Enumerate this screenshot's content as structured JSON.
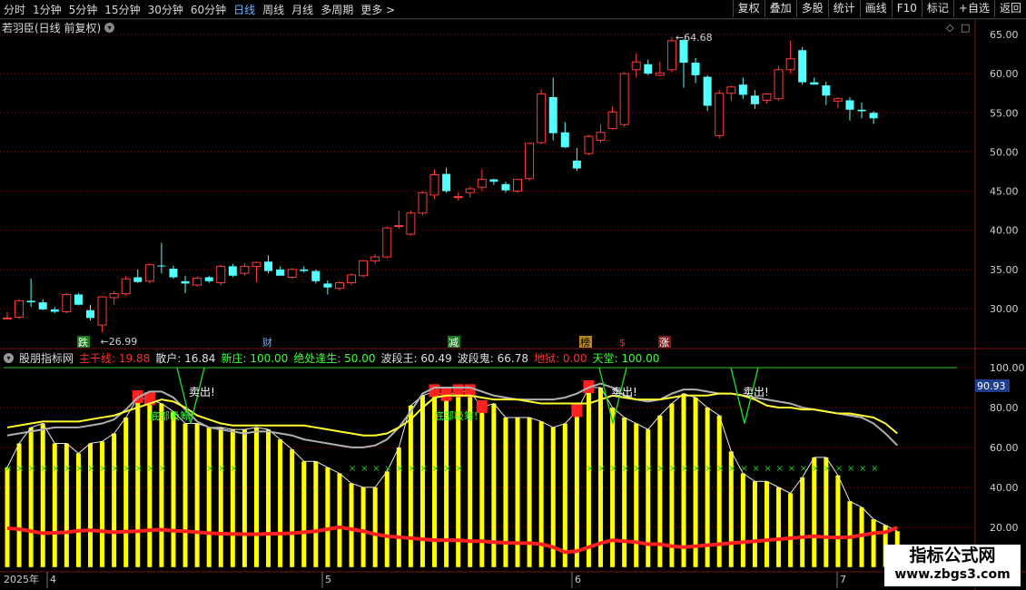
{
  "toolbar": {
    "periods": [
      "分时",
      "1分钟",
      "5分钟",
      "15分钟",
      "30分钟",
      "60分钟",
      "日线",
      "周线",
      "月线",
      "多周期",
      "更多 >"
    ],
    "active_period": "日线",
    "buttons": [
      "复权",
      "叠加",
      "多股",
      "统计",
      "画线",
      "F10",
      "标记",
      "+自选",
      "返回"
    ]
  },
  "main_header": {
    "title": "若羽臣(日线 前复权)",
    "menu_icon": "chevron-down-icon"
  },
  "price_axis": {
    "ticks": [
      "65.00",
      "60.00",
      "55.00",
      "50.00",
      "45.00",
      "40.00",
      "35.00",
      "30.00"
    ],
    "max": 64.68,
    "min": 26.99,
    "max_label": "64.68",
    "min_label": "26.99"
  },
  "signals": [
    {
      "text": "跌",
      "bg": "#1e7a1e",
      "fg": "#ffffff"
    },
    {
      "text": "财",
      "bg": "#000000",
      "fg": "#6bb7ff"
    },
    {
      "text": "减",
      "bg": "#1e7a1e",
      "fg": "#ffffff"
    },
    {
      "text": "榜",
      "bg": "#b58a1e",
      "fg": "#000000"
    },
    {
      "text": "$",
      "bg": "#000000",
      "fg": "#ff3030"
    },
    {
      "text": "涨",
      "bg": "#7a1e1e",
      "fg": "#ffffff"
    }
  ],
  "indicator": {
    "name": "股朋指标网",
    "items": [
      {
        "label": "主干线: 19.88",
        "color": "#ff3030"
      },
      {
        "label": "散户: 16.84",
        "color": "#e0e0e0"
      },
      {
        "label": "新庄: 100.00",
        "color": "#40ff40"
      },
      {
        "label": "绝处逢生: 50.00",
        "color": "#40ff40"
      },
      {
        "label": "波段王: 60.49",
        "color": "#e0e0e0"
      },
      {
        "label": "波段鬼: 66.78",
        "color": "#e0e0e0"
      },
      {
        "label": "地狱: 0.00",
        "color": "#ff3030"
      },
      {
        "label": "天堂: 100.00",
        "color": "#40ff40"
      }
    ],
    "axis_ticks": [
      "100.00",
      "80.00",
      "60.00",
      "40.00",
      "20.00"
    ],
    "current_value": "90.93",
    "annotations": {
      "sell": "卖出!",
      "bottom": "底部吸筹!"
    }
  },
  "time_axis": {
    "year_label": "2025年",
    "months": [
      "4",
      "5",
      "6",
      "7"
    ]
  },
  "watermark": {
    "line1": "指标公式网",
    "line2": "www.zbgs3.com"
  },
  "colors": {
    "up": "#ff3c3c",
    "down": "#54ffff",
    "bar_yellow": "#ffff00",
    "grid": "#7a1010",
    "green": "#22cc22"
  },
  "chart_data": {
    "type": "candlestick",
    "candles": [
      [
        28.7,
        29.6,
        28.6,
        28.8
      ],
      [
        28.9,
        31.2,
        28.7,
        31.0
      ],
      [
        31.0,
        33.8,
        30.2,
        30.8
      ],
      [
        30.8,
        31.2,
        29.8,
        29.9
      ],
      [
        29.9,
        30.2,
        29.4,
        29.6
      ],
      [
        29.6,
        32.0,
        29.4,
        31.8
      ],
      [
        31.8,
        32.0,
        30.4,
        30.5
      ],
      [
        29.8,
        30.5,
        28.5,
        28.8
      ],
      [
        27.9,
        31.6,
        26.99,
        31.5
      ],
      [
        31.4,
        32.2,
        30.5,
        31.9
      ],
      [
        31.9,
        34.2,
        31.6,
        33.8
      ],
      [
        34.0,
        35.0,
        33.3,
        33.4
      ],
      [
        33.5,
        35.8,
        33.2,
        35.6
      ],
      [
        35.5,
        38.4,
        34.5,
        35.4
      ],
      [
        35.1,
        35.5,
        33.8,
        34.0
      ],
      [
        33.5,
        34.2,
        32.0,
        33.2
      ],
      [
        33.0,
        34.1,
        32.8,
        33.9
      ],
      [
        34.0,
        34.2,
        33.3,
        33.5
      ],
      [
        33.3,
        35.6,
        33.0,
        35.4
      ],
      [
        35.4,
        35.7,
        34.0,
        34.2
      ],
      [
        34.5,
        35.8,
        34.2,
        35.4
      ],
      [
        35.4,
        36.0,
        33.4,
        35.9
      ],
      [
        36.0,
        36.8,
        34.5,
        34.8
      ],
      [
        35.0,
        35.4,
        34.6,
        34.2
      ],
      [
        34.0,
        35.2,
        33.8,
        35.0
      ],
      [
        35.0,
        35.4,
        34.6,
        34.8
      ],
      [
        34.8,
        35.0,
        33.2,
        33.5
      ],
      [
        33.2,
        33.6,
        31.8,
        32.7
      ],
      [
        32.6,
        33.5,
        32.3,
        33.3
      ],
      [
        33.3,
        34.5,
        33.0,
        34.3
      ],
      [
        34.2,
        36.2,
        34.0,
        36.1
      ],
      [
        36.1,
        37.0,
        35.7,
        36.6
      ],
      [
        36.6,
        40.5,
        36.4,
        40.3
      ],
      [
        40.5,
        42.5,
        40.2,
        40.6
      ],
      [
        39.5,
        42.5,
        39.3,
        42.2
      ],
      [
        42.2,
        45.0,
        41.9,
        44.8
      ],
      [
        44.5,
        47.8,
        44.0,
        47.1
      ],
      [
        47.2,
        48.0,
        44.8,
        45.0
      ],
      [
        44.3,
        44.8,
        43.8,
        44.3
      ],
      [
        44.8,
        45.6,
        44.2,
        45.3
      ],
      [
        45.5,
        47.8,
        45.0,
        46.5
      ],
      [
        46.5,
        46.6,
        45.8,
        46.2
      ],
      [
        45.9,
        46.2,
        44.8,
        45.1
      ],
      [
        45.0,
        46.2,
        44.8,
        46.5
      ],
      [
        46.6,
        51.2,
        46.3,
        51.1
      ],
      [
        51.2,
        58.0,
        51.0,
        57.4
      ],
      [
        57.0,
        59.5,
        51.5,
        52.4
      ],
      [
        52.5,
        53.8,
        50.5,
        50.6
      ],
      [
        48.9,
        50.5,
        47.6,
        47.9
      ],
      [
        49.8,
        52.2,
        49.6,
        52.0
      ],
      [
        51.5,
        53.5,
        51.2,
        52.5
      ],
      [
        53.0,
        55.8,
        52.8,
        55.1
      ],
      [
        53.5,
        60.2,
        53.2,
        60.0
      ],
      [
        60.5,
        62.6,
        59.5,
        61.5
      ],
      [
        61.2,
        61.8,
        59.8,
        60.0
      ],
      [
        59.8,
        61.5,
        59.7,
        60.1
      ],
      [
        60.5,
        64.68,
        60.2,
        64.2
      ],
      [
        64.3,
        64.4,
        58.2,
        61.4
      ],
      [
        61.4,
        62.0,
        58.8,
        59.8
      ],
      [
        59.6,
        59.8,
        55.2,
        55.9
      ],
      [
        52.1,
        57.9,
        51.7,
        57.5
      ],
      [
        57.5,
        58.5,
        56.5,
        58.3
      ],
      [
        58.6,
        59.5,
        56.8,
        57.3
      ],
      [
        57.2,
        57.9,
        55.5,
        56.1
      ],
      [
        56.6,
        57.5,
        56.2,
        57.4
      ],
      [
        56.8,
        61.0,
        56.5,
        60.5
      ],
      [
        60.5,
        64.2,
        60.0,
        61.9
      ],
      [
        63.0,
        63.4,
        58.6,
        58.9
      ],
      [
        58.9,
        59.5,
        58.6,
        58.6
      ],
      [
        58.5,
        59.0,
        56.0,
        57.2
      ],
      [
        56.5,
        57.0,
        55.6,
        56.8
      ],
      [
        56.6,
        57.0,
        54.0,
        55.4
      ],
      [
        55.4,
        56.3,
        54.3,
        55.2
      ],
      [
        55.0,
        55.2,
        53.6,
        54.3
      ]
    ],
    "indicator_series": {
      "yellow_bars": [
        50,
        62,
        70,
        72,
        62,
        62,
        57,
        62,
        63,
        67,
        75,
        85,
        84,
        82,
        78,
        72,
        72,
        70,
        70,
        69,
        69,
        70,
        69,
        64,
        59,
        53,
        53,
        50,
        47,
        42,
        40,
        40,
        48,
        60,
        81,
        86,
        88,
        86,
        88,
        88,
        80,
        82,
        75,
        75,
        75,
        73,
        70,
        72,
        78,
        90,
        90,
        80,
        75,
        72,
        69,
        76,
        82,
        87,
        85,
        80,
        76,
        58,
        47,
        43,
        43,
        40,
        37,
        45,
        55,
        55,
        46,
        33,
        30,
        24,
        21,
        18
      ],
      "red_line": [
        19.5,
        19.0,
        18.0,
        17.0,
        17.2,
        17.5,
        18.2,
        18.5,
        18.0,
        17.5,
        17.8,
        18.0,
        18.5,
        18.8,
        18.2,
        18.0,
        17.5,
        17.0,
        16.8,
        16.6,
        16.5,
        16.5,
        16.7,
        16.8,
        17.0,
        17.5,
        18.0,
        19.0,
        20.0,
        19.0,
        18.0,
        16.5,
        15.5,
        15.0,
        14.5,
        14.0,
        13.5,
        13.5,
        13.5,
        13.0,
        13.0,
        12.5,
        12.2,
        12.0,
        12.0,
        11.5,
        10.0,
        7.5,
        8.0,
        10.0,
        12.0,
        13.5,
        13.0,
        12.5,
        11.5,
        11.5,
        10.5,
        10.0,
        10.5,
        11.0,
        11.5,
        12.0,
        12.5,
        13.0,
        13.5,
        14.0,
        14.5,
        15.0,
        15.5,
        15.0,
        14.8,
        15.0,
        16.0,
        17.0,
        17.5,
        19.9
      ],
      "yellow_line": [
        70,
        71,
        72,
        73,
        73,
        73,
        73,
        74,
        75,
        76,
        78,
        80,
        82,
        84,
        83,
        80,
        76,
        74,
        72,
        71,
        71,
        71,
        71,
        71,
        71,
        71,
        70,
        69,
        68,
        67,
        66,
        66,
        67,
        70,
        74,
        80,
        85,
        86,
        86,
        86,
        85,
        84,
        84,
        84,
        83,
        82,
        82,
        82,
        82,
        82,
        84,
        86,
        85,
        84,
        84,
        84,
        85,
        86,
        86,
        86,
        87,
        87,
        86,
        84,
        81,
        80,
        80,
        79,
        79,
        78,
        77,
        77,
        76,
        75,
        72,
        67
      ],
      "gray_line": [
        66,
        67,
        68,
        69,
        70,
        70,
        70,
        71,
        72,
        74,
        79,
        85,
        88,
        88,
        85,
        79,
        73,
        70,
        69,
        68,
        67,
        68,
        68,
        67,
        66,
        64,
        63,
        62,
        61,
        60,
        60,
        61,
        64,
        70,
        78,
        87,
        90,
        90,
        90,
        90,
        88,
        86,
        85,
        84,
        84,
        84,
        84,
        85,
        87,
        90,
        92,
        90,
        86,
        84,
        83,
        84,
        87,
        89,
        89,
        88,
        87,
        87,
        86,
        85,
        84,
        83,
        82,
        80,
        79,
        78,
        77,
        76,
        75,
        72,
        67,
        61
      ]
    }
  }
}
